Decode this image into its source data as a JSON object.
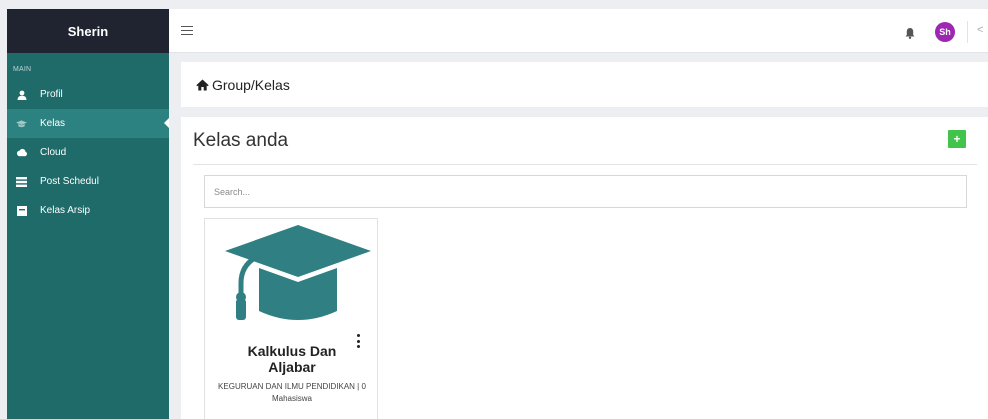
{
  "sidebar": {
    "brand": "Sherin",
    "section_label": "MAIN",
    "items": [
      {
        "label": "Profil",
        "icon": "user-icon",
        "active": false
      },
      {
        "label": "Kelas",
        "icon": "graduation-cap-icon",
        "active": true
      },
      {
        "label": "Cloud",
        "icon": "cloud-icon",
        "active": false
      },
      {
        "label": "Post Schedul",
        "icon": "list-icon",
        "active": false
      },
      {
        "label": "Kelas Arsip",
        "icon": "archive-icon",
        "active": false
      }
    ]
  },
  "topbar": {
    "avatar_initials": "Sh",
    "collapse_glyph": "<"
  },
  "breadcrumb": {
    "text": "Group/Kelas"
  },
  "main": {
    "title": "Kelas anda",
    "add_label": "+",
    "search_placeholder": "Search...",
    "cards": [
      {
        "title": "Kalkulus Dan Aljabar",
        "subtitle": "KEGURUAN DAN ILMU PENDIDIKAN | 0 Mahasiswa"
      }
    ]
  },
  "colors": {
    "sidebar_bg": "#1e6b6a",
    "sidebar_active": "#2c8280",
    "brand_bg": "#1f2430",
    "accent_green": "#41c34c",
    "avatar_purple": "#9c27b0",
    "cap_teal": "#2f7f83"
  }
}
